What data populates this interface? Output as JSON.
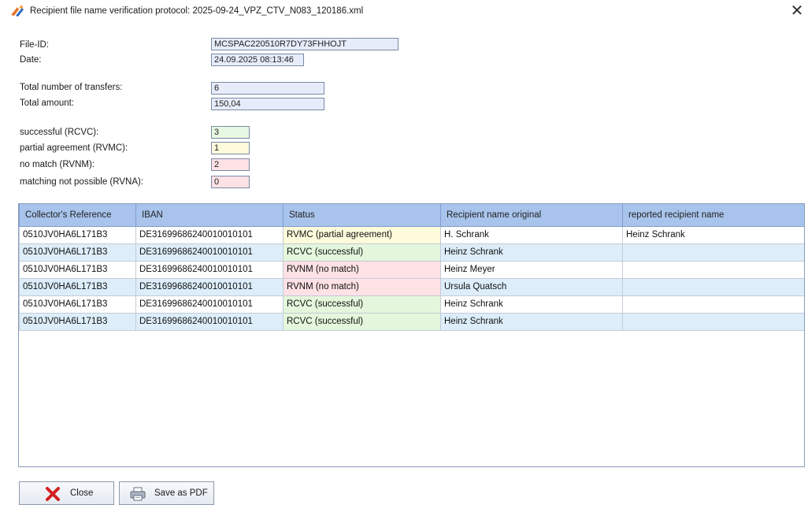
{
  "window": {
    "title": "Recipient file name verification protocol:  2025-09-24_VPZ_CTV_N083_120186.xml",
    "close_glyph": "✕"
  },
  "summary": {
    "file_id_label": "File-ID:",
    "file_id_value": "MCSPAC220510R7DY73FHHOJT",
    "date_label": "Date:",
    "date_value": "24.09.2025 08:13:46",
    "total_transfers_label": "Total number of transfers:",
    "total_transfers_value": "6",
    "total_amount_label": "Total amount:",
    "total_amount_value": "150,04",
    "successful_label": "successful (RCVC):",
    "successful_value": "3",
    "partial_label": "partial agreement (RVMC):",
    "partial_value": "1",
    "nomatch_label": "no match (RVNM):",
    "nomatch_value": "2",
    "notpossible_label": "matching not possible (RVNA):",
    "notpossible_value": "0"
  },
  "table": {
    "columns": [
      "Collector's Reference",
      "IBAN",
      "Status",
      "Recipient name original",
      "reported recipient name"
    ],
    "rows": [
      {
        "ref": "0510JV0HA6L171B3",
        "iban": "DE31699686240010010101",
        "status": "RVMC  (partial agreement)",
        "status_color": "#fdfbdb",
        "original": "H. Schrank",
        "reported": "Heinz Schrank"
      },
      {
        "ref": "0510JV0HA6L171B3",
        "iban": "DE31699686240010010101",
        "status": "RCVC  (successful)",
        "status_color": "#e4f7dc",
        "original": "Heinz Schrank",
        "reported": ""
      },
      {
        "ref": "0510JV0HA6L171B3",
        "iban": "DE31699686240010010101",
        "status": "RVNM  (no match)",
        "status_color": "#fde1e4",
        "original": "Heinz Meyer",
        "reported": ""
      },
      {
        "ref": "0510JV0HA6L171B3",
        "iban": "DE31699686240010010101",
        "status": "RVNM  (no match)",
        "status_color": "#fde1e4",
        "original": "Ursula Quatsch",
        "reported": ""
      },
      {
        "ref": "0510JV0HA6L171B3",
        "iban": "DE31699686240010010101",
        "status": "RCVC  (successful)",
        "status_color": "#e4f7dc",
        "original": "Heinz Schrank",
        "reported": ""
      },
      {
        "ref": "0510JV0HA6L171B3",
        "iban": "DE31699686240010010101",
        "status": "RCVC  (successful)",
        "status_color": "#e4f7dc",
        "original": "Heinz Schrank",
        "reported": ""
      }
    ]
  },
  "buttons": {
    "close_label": "Close",
    "save_pdf_label": "Save as PDF"
  },
  "icons": {
    "app": "app-logo-icon",
    "window_close": "close-icon",
    "close_button": "red-x-icon",
    "save_pdf_button": "printer-icon"
  },
  "colors": {
    "header_bg": "#a8c4ec",
    "row_alt_bg": "#ddeefa",
    "successful": "#e4f7dc",
    "partial": "#fdfbdb",
    "no_match": "#fde1e4"
  }
}
